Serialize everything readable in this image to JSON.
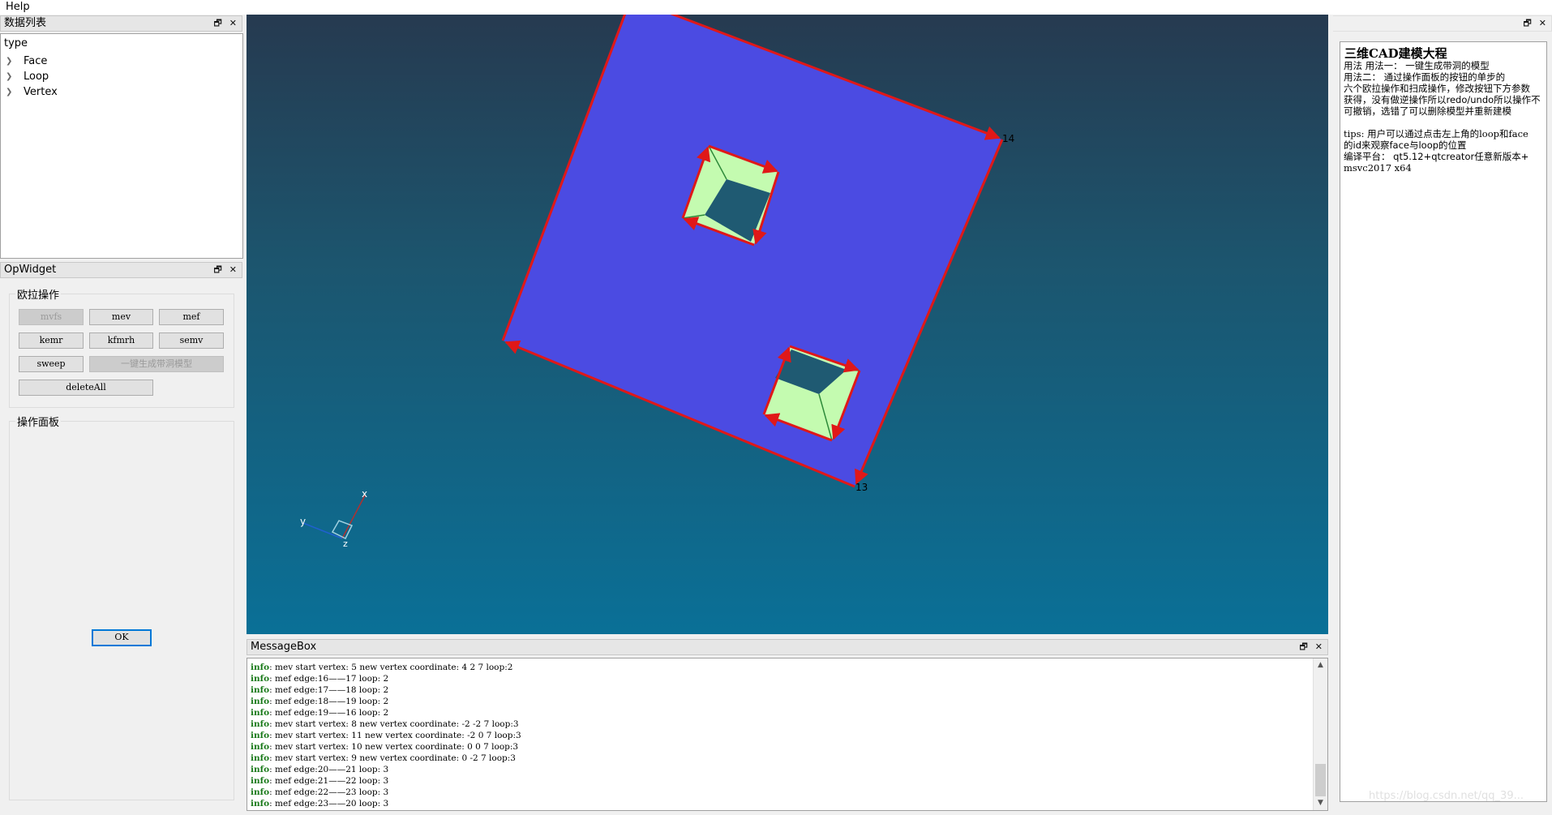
{
  "menubar": {
    "help": "Help"
  },
  "data_list": {
    "title": "数据列表",
    "header": "type",
    "items": [
      "Face",
      "Loop",
      "Vertex"
    ]
  },
  "opwidget": {
    "title": "OpWidget",
    "euler_group": "欧拉操作",
    "buttons": {
      "mvfs": "mvfs",
      "mev": "mev",
      "mef": "mef",
      "kemr": "kemr",
      "kfmrh": "kfmrh",
      "semv": "semv",
      "sweep": "sweep",
      "gen_model": "一键生成带洞模型",
      "delete_all": "deleteAll"
    },
    "panel_group": "操作面板",
    "ok": "OK"
  },
  "viewport": {
    "vertex_labels": [
      "14",
      "13"
    ],
    "axes": {
      "x": "x",
      "y": "y",
      "z": "z"
    },
    "colors": {
      "face": "#4b4be2",
      "edge": "#e01818",
      "hole": "#c4fbb0",
      "bg_top": "#263a50",
      "bg_bottom": "#0a7097"
    }
  },
  "messagebox": {
    "title": "MessageBox",
    "prefix": "info",
    "lines": [
      ": mev start vertex: 5 new vertex coordinate: 4 2 7 loop:2",
      ": mef edge:16——17 loop: 2",
      ": mef edge:17——18 loop: 2",
      ": mef edge:18——19 loop: 2",
      ": mef edge:19——16 loop: 2",
      ": mev start vertex: 8 new vertex coordinate: -2 -2 7 loop:3",
      ": mev start vertex: 11 new vertex coordinate: -2 0 7 loop:3",
      ": mev start vertex: 10 new vertex coordinate: 0 0 7 loop:3",
      ": mev start vertex: 9 new vertex coordinate: 0 -2 7 loop:3",
      ": mef edge:20——21 loop: 3",
      ": mef edge:21——22 loop: 3",
      ": mef edge:22——23 loop: 3",
      ": mef edge:23——20 loop: 3"
    ]
  },
  "help": {
    "title": "三维CAD建模大程",
    "lines": [
      "用法  用法一：  一键生成带洞的模型",
      "          用法二：  通过操作面板的按钮的单步的",
      "六个欧拉操作和扫成操作，修改按钮下方参数",
      "获得，没有做逆操作所以redo/undo所以操作不",
      "可撤销，选错了可以删除模型并重新建模",
      "",
      "tips: 用户可以通过点击左上角的loop和face",
      "的id来观察face与loop的位置",
      "编译平台：  qt5.12+qtcreator任意新版本+",
      "msvc2017 x64"
    ]
  },
  "watermark": "https://blog.csdn.net/qq_39..."
}
